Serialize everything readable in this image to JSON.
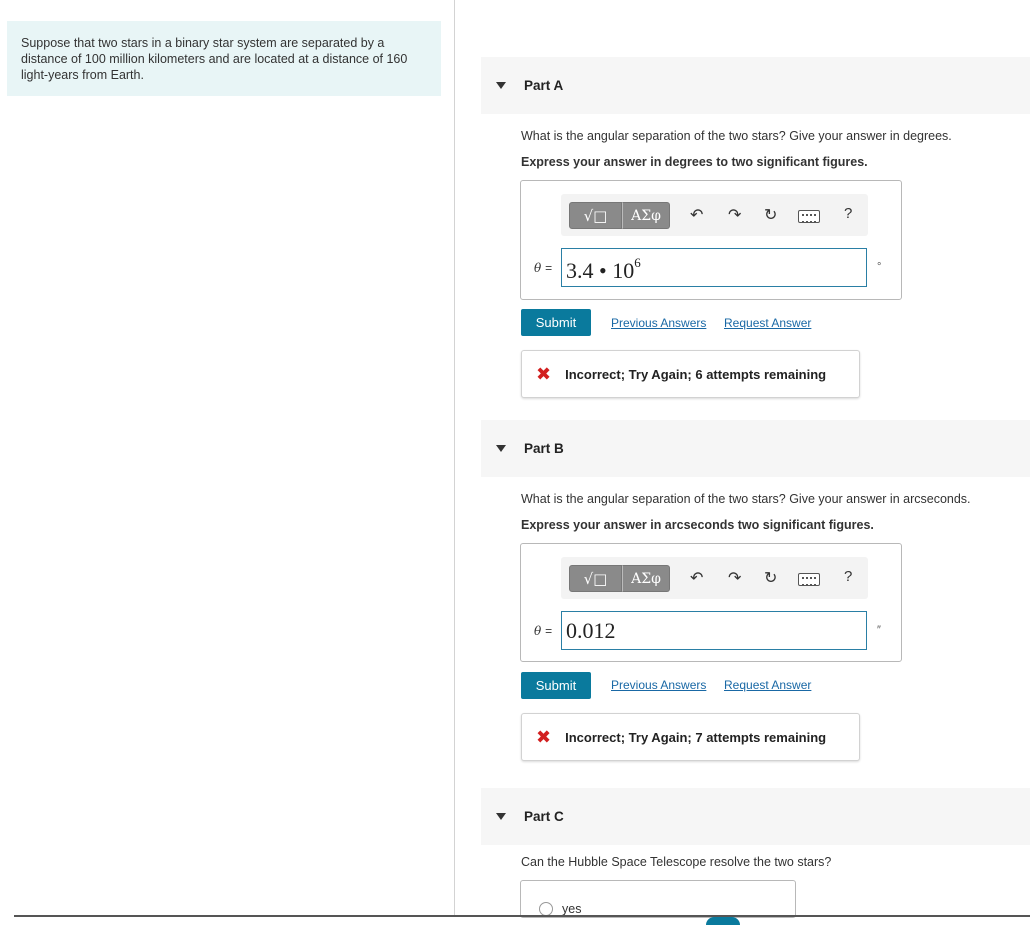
{
  "intro": {
    "text": "Suppose that two stars in a binary star system are separated by a distance of 100 million kilometers and are located at a distance of 160 light-years from Earth."
  },
  "toolbar": {
    "templates_label": "√□",
    "greek_label": "ΑΣφ",
    "help_label": "?"
  },
  "parts": [
    {
      "title": "Part A",
      "question": "What is the angular separation of the two stars? Give your answer in degrees.",
      "instruction": "Express your answer in degrees to two significant figures.",
      "variable": "θ",
      "equals": "=",
      "answer_mantissa": "3.4 • 10",
      "answer_exponent": "6",
      "unit": "°",
      "submit_label": "Submit",
      "previous_answers_label": "Previous Answers",
      "request_answer_label": "Request Answer",
      "feedback": "Incorrect; Try Again; 6 attempts remaining"
    },
    {
      "title": "Part B",
      "question": "What is the angular separation of the two stars? Give your answer in arcseconds.",
      "instruction": "Express your answer in arcseconds two significant figures.",
      "variable": "θ",
      "equals": "=",
      "answer_value": "0.012",
      "unit": "″",
      "submit_label": "Submit",
      "previous_answers_label": "Previous Answers",
      "request_answer_label": "Request Answer",
      "feedback": "Incorrect; Try Again; 7 attempts remaining"
    },
    {
      "title": "Part C",
      "question": "Can the Hubble Space Telescope resolve the two stars?",
      "choices": [
        "yes"
      ]
    }
  ],
  "icons": {
    "undo": "undo-icon",
    "redo": "redo-icon",
    "reset": "reset-icon",
    "keyboard": "keyboard-icon",
    "error": "x-mark-icon",
    "caret": "caret-down-icon"
  },
  "colors": {
    "intro_bg": "#e8f5f6",
    "submit_bg": "#0a7a9d",
    "link": "#1968a5",
    "error": "#d21f1f",
    "input_border": "#2a7fa5"
  }
}
